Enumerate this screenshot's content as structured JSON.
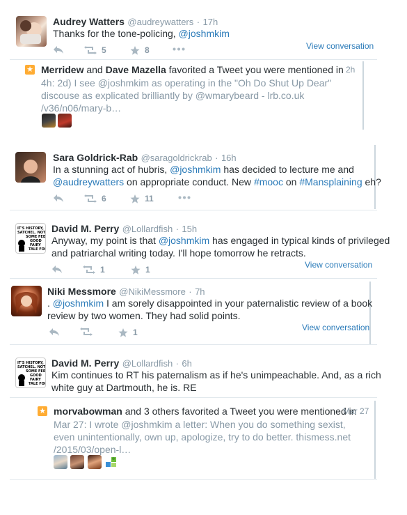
{
  "t1": {
    "name": "Audrey Watters",
    "handle": "@audreywatters",
    "time": "17h",
    "text_pre": "Thanks for the tone-policing, ",
    "text_link": "@joshmkim",
    "retweets": "5",
    "favorites": "8",
    "view": "View conversation"
  },
  "n1": {
    "title_a": "Merridew",
    "title_mid": " and ",
    "title_b": "Dave Mazella",
    "title_rest": " favorited a Tweet you were mentioned in",
    "time": "2h",
    "quote_l1": "4h: 2d) I see @joshmkim as operating in the \"Oh Do Shut Up Dear\"",
    "quote_l2": "discouse as explicated brilliantly by @wmarybeard - lrb.co.uk",
    "quote_l3": "/v36/n06/mary-b…"
  },
  "t2": {
    "name": "Sara Goldrick-Rab",
    "handle": "@saragoldrickrab",
    "time": "16h",
    "l1_pre": "In a stunning act of hubris, ",
    "l1_link": "@joshmkim",
    "l1_post": " has decided to lecture me and",
    "l2_link1": "@audreywatters",
    "l2_mid": " on appropriate conduct. New ",
    "l2_link2": "#mooc",
    "l2_mid2": " on ",
    "l2_link3": "#Mansplaining",
    "l2_post": "  eh?",
    "retweets": "6",
    "favorites": "11"
  },
  "t3": {
    "name": "David M. Perry",
    "handle": "@Lollardfish",
    "time": "15h",
    "l1_pre": "Anyway, my point is that ",
    "l1_link": "@joshmkim",
    "l1_post": " has engaged in typical kinds of privileged",
    "l2": "and patriarchal writing today. I'll hope tomorrow he retracts.",
    "retweets": "1",
    "favorites": "1",
    "view": "View conversation",
    "avatar_text": "IT'S HISTORY, SATCHEL. NOT SOME FEEL-GOOD FAIRY TALE FOR LOSERS."
  },
  "t4": {
    "name": "Niki Messmore",
    "handle": "@NikiMessmore",
    "time": "7h",
    "l1_pre": ". ",
    "l1_link": "@joshmkim",
    "l1_post": " I am sorely disappointed in your paternalistic review of a book",
    "l2": "review by two women. They had solid points.",
    "favorites": "1",
    "view": "View conversation"
  },
  "t5": {
    "name": "David M. Perry",
    "handle": "@Lollardfish",
    "time": "6h",
    "l1": "Kim continues to RT his paternalism as if he's unimpeachable. And, as a rich",
    "l2": "white guy at Dartmouth, he is. RE",
    "avatar_text": "IT'S HISTORY, SATCHEL. NOT SOME FEEL-GOOD FAIRY TALE FOR LOSERS."
  },
  "n2": {
    "title_a": "morvabowman",
    "title_rest": " and 3 others favorited a Tweet you were mentioned in",
    "time": "Mar 27",
    "quote_l1": "Mar 27: I wrote @joshmkim a letter: When you do something sexist,",
    "quote_l2": "even unintentionally, own up, apologize, try to do better. thismess.net",
    "quote_l3": "/2015/03/open-l…"
  },
  "colors": {
    "link": "#2b7bb9",
    "muted": "#8899a6",
    "star": "#ffac33",
    "divider": "#e1e8ed"
  },
  "icons": [
    "reply-icon",
    "retweet-icon",
    "favorite-icon",
    "more-icon",
    "star-notification-icon"
  ]
}
